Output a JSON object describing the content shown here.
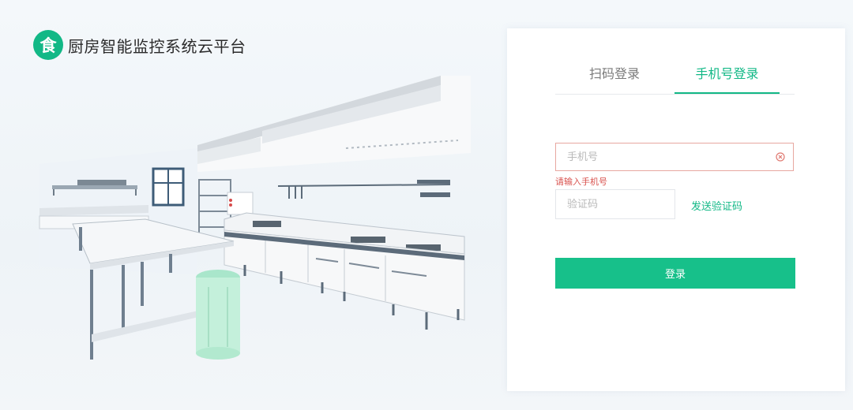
{
  "brand": {
    "logo_char": "食",
    "title": "厨房智能监控系统云平台"
  },
  "tabs": [
    {
      "label": "扫码登录",
      "active": false
    },
    {
      "label": "手机号登录",
      "active": true
    }
  ],
  "form": {
    "phone_placeholder": "手机号",
    "phone_value": "",
    "phone_error": "请输入手机号",
    "code_placeholder": "验证码",
    "code_value": "",
    "send_code_label": "发送验证码",
    "login_label": "登录"
  },
  "colors": {
    "accent": "#12b886",
    "error": "#d9534f"
  },
  "icons": {
    "clear": "close-circle-icon"
  }
}
